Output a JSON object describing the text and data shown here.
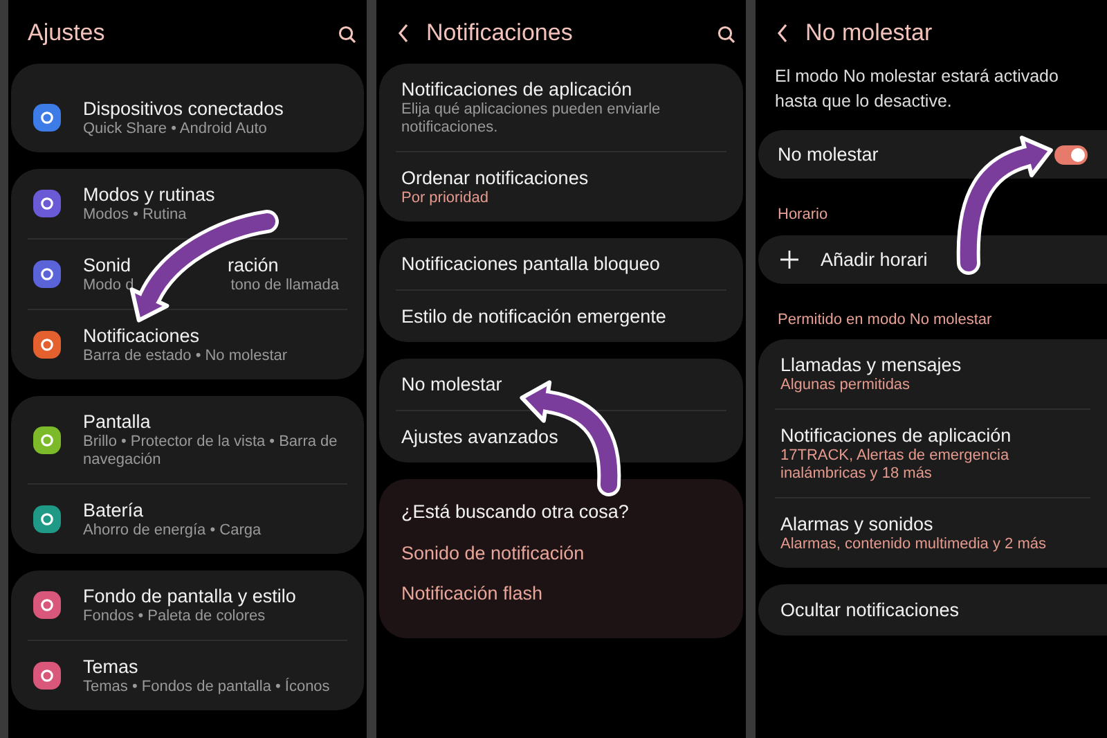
{
  "screens": [
    {
      "title": "Ajustes",
      "back": false,
      "search": true,
      "blocks": [
        {
          "kind": "group",
          "items": [
            {
              "title": [
                "Dispositivos conectados"
              ],
              "subtitle": [
                "Quick Share • Android Auto"
              ],
              "accent": false,
              "color": "#3d7be6"
            }
          ]
        },
        {
          "kind": "group",
          "items": [
            {
              "title": [
                "Modos y rutinas"
              ],
              "subtitle": [
                "Modos • Rutina"
              ],
              "accent": false,
              "color": "#6a5ad6"
            },
            {
              "title": [
                "Sonid",
                "ración"
              ],
              "subtitle": [
                "Modo d",
                "tono de llamada"
              ],
              "accent": false,
              "color": "#5b63d9"
            },
            {
              "title": [
                "Notificaciones"
              ],
              "subtitle": [
                "Barra de estado • No molestar"
              ],
              "accent": false,
              "color": "#e4612f"
            }
          ]
        },
        {
          "kind": "group",
          "items": [
            {
              "title": [
                "Pantalla"
              ],
              "subtitle": [
                "Brillo • Protector de la vista • Barra de navegación"
              ],
              "accent": false,
              "color": "#7cba2a"
            },
            {
              "title": [
                "Batería"
              ],
              "subtitle": [
                "Ahorro de energía • Carga"
              ],
              "accent": false,
              "color": "#1e9a86"
            }
          ]
        },
        {
          "kind": "group",
          "items": [
            {
              "title": [
                "Fondo de pantalla y estilo"
              ],
              "subtitle": [
                "Fondos • Paleta de colores"
              ],
              "accent": false,
              "color": "#d8577a"
            },
            {
              "title": [
                "Temas"
              ],
              "subtitle": [
                "Temas • Fondos de pantalla • Íconos"
              ],
              "accent": false,
              "color": "#d8577a"
            }
          ]
        }
      ]
    },
    {
      "title": "Notificaciones",
      "back": true,
      "search": true,
      "blocks": [
        {
          "kind": "group",
          "items": [
            {
              "title": [
                "Notificaciones de aplicación"
              ],
              "subtitle": [
                "Elija qué aplicaciones pueden enviarle notificaciones."
              ],
              "accent": false
            },
            {
              "title": [
                "Ordenar notificaciones"
              ],
              "subtitle": [
                "Por prioridad"
              ],
              "accent": true
            }
          ]
        },
        {
          "kind": "group",
          "items": [
            {
              "title": [
                "Notificaciones pantalla bloqueo"
              ]
            },
            {
              "title": [
                "Estilo de notificación emergente"
              ]
            }
          ]
        },
        {
          "kind": "group",
          "items": [
            {
              "title": [
                "No molestar"
              ]
            },
            {
              "title": [
                "Ajustes avanzados"
              ]
            }
          ]
        },
        {
          "kind": "suggestions",
          "heading": "¿Está buscando otra cosa?",
          "links": [
            "Sonido de notificación",
            "Notificación flash"
          ]
        }
      ]
    },
    {
      "title": "No molestar",
      "back": true,
      "search": false,
      "blocks": [
        {
          "kind": "note",
          "text": "El modo No molestar estará activado hasta que lo desactive."
        },
        {
          "kind": "toggle",
          "label": "No molestar",
          "on": true
        },
        {
          "kind": "header",
          "text": "Horario"
        },
        {
          "kind": "add",
          "label": "Añadir horari"
        },
        {
          "kind": "header",
          "text": "Permitido en modo No molestar"
        },
        {
          "kind": "group",
          "items": [
            {
              "title": [
                "Llamadas y mensajes"
              ],
              "subtitle": [
                "Algunas permitidas"
              ],
              "accent": true
            },
            {
              "title": [
                "Notificaciones de aplicación"
              ],
              "subtitle": [
                "17TRACK, Alertas de emergencia inalámbricas y 18 más"
              ],
              "accent": true
            },
            {
              "title": [
                "Alarmas y sonidos"
              ],
              "subtitle": [
                "Alarmas, contenido multimedia y 2 más"
              ],
              "accent": true
            }
          ]
        },
        {
          "kind": "group",
          "items": [
            {
              "title": [
                "Ocultar notificaciones"
              ]
            }
          ]
        }
      ]
    }
  ]
}
